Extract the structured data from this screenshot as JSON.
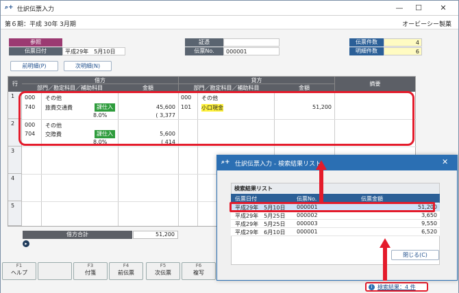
{
  "app": {
    "title": "仕訳伝票入力",
    "period": "第６期：平成 30年 3月期",
    "company": "オービーシー製菓"
  },
  "header": {
    "reference_label": "参照",
    "voucher_date_label": "伝票日付",
    "voucher_date": "平成29年　5月10日",
    "evidence_label": "証憑",
    "evidence_value": "",
    "voucher_no_label": "伝票No.",
    "voucher_no": "000001",
    "voucher_count_label": "伝票件数",
    "voucher_count": "4",
    "detail_count_label": "明細件数",
    "detail_count": "6"
  },
  "nav": {
    "prev": "前明細(P)",
    "next": "次明細(N)"
  },
  "grid": {
    "row_header": "行",
    "debit_header": "借方",
    "credit_header": "貸方",
    "summary_header": "摘要",
    "sub_account": "部門／勘定科目／補助科目",
    "amount": "金額",
    "rows": [
      {
        "no": "1",
        "d_dept": "000",
        "d_dept_name": "その他",
        "d_acct": "740",
        "d_acct_name": "旅費交通費",
        "d_tax": "課仕入",
        "d_amount": "45,600",
        "d_rate": "8.0%",
        "d_tax_amt": "( 3,377",
        "c_dept": "000",
        "c_dept_name": "その他",
        "c_acct": "101",
        "c_acct_name": "小口現金",
        "c_amount": "51,200"
      },
      {
        "no": "2",
        "d_dept": "000",
        "d_dept_name": "その他",
        "d_acct": "704",
        "d_acct_name": "交際費",
        "d_tax": "課仕入",
        "d_amount": "5,600",
        "d_rate": "8.0%",
        "d_tax_amt": "( 414"
      },
      {
        "no": "3"
      },
      {
        "no": "4"
      },
      {
        "no": "5"
      }
    ]
  },
  "totals": {
    "debit_label": "借方合計",
    "debit_total": "51,200"
  },
  "fkeys": [
    {
      "key": "F1",
      "label": "ヘルプ"
    },
    {
      "key": "",
      "label": ""
    },
    {
      "key": "F3",
      "label": "付箋"
    },
    {
      "key": "F4",
      "label": "前伝票"
    },
    {
      "key": "F5",
      "label": "次伝票"
    },
    {
      "key": "F6",
      "label": "複写"
    }
  ],
  "status": {
    "search_result": "検索結果：4 件"
  },
  "popup": {
    "title": "仕訳伝票入力 - 検索結果リスト",
    "list_title": "検索結果リスト",
    "columns": [
      "伝票日付",
      "伝票No.",
      "伝票金額"
    ],
    "rows": [
      {
        "date": "平成29年　5月10日",
        "no": "000001",
        "amount": "51,200"
      },
      {
        "date": "平成29年　5月25日",
        "no": "000002",
        "amount": "3,650"
      },
      {
        "date": "平成29年　5月25日",
        "no": "000003",
        "amount": "9,550"
      },
      {
        "date": "平成29年　6月10日",
        "no": "000001",
        "amount": "6,520"
      }
    ],
    "close": "閉じる(C)"
  },
  "colors": {
    "accent": "#2b6fb3",
    "highlight": "#e41b2b",
    "tag": "#2e9c3c"
  }
}
